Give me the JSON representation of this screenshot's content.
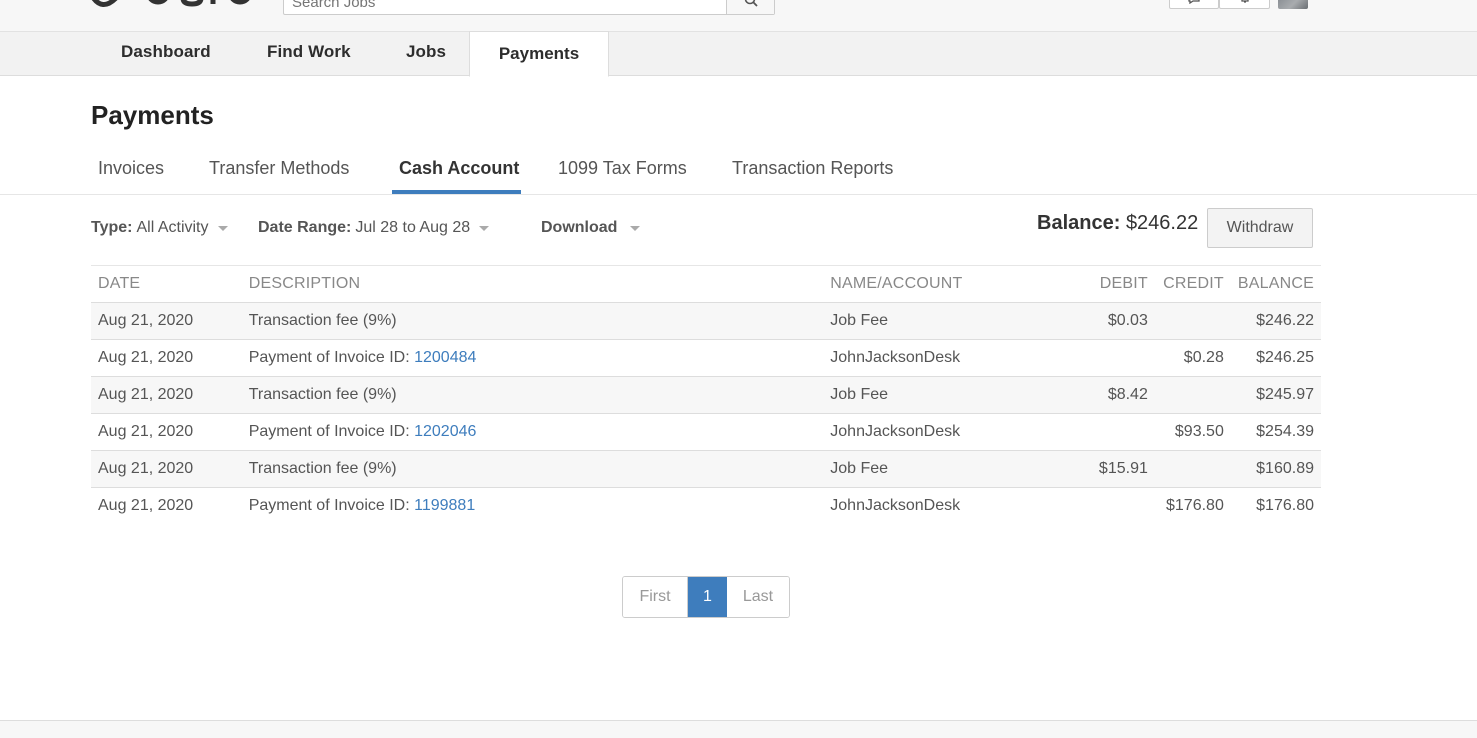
{
  "header": {
    "logo_icon": "logo",
    "search": {
      "placeholder": "Search Jobs"
    },
    "icons": [
      "search-icon",
      "chat-icon",
      "bell-icon",
      "avatar"
    ]
  },
  "main_nav": {
    "items": [
      {
        "label": "Dashboard"
      },
      {
        "label": "Find Work"
      },
      {
        "label": "Jobs"
      },
      {
        "label": "Payments"
      }
    ]
  },
  "page": {
    "title": "Payments",
    "subtabs": [
      {
        "label": "Invoices"
      },
      {
        "label": "Transfer Methods"
      },
      {
        "label": "Cash Account"
      },
      {
        "label": "1099 Tax Forms"
      },
      {
        "label": "Transaction Reports"
      }
    ]
  },
  "filters": {
    "type_label": "Type:",
    "type_value": "All Activity",
    "date_label": "Date Range:",
    "date_value": "Jul 28 to Aug 28",
    "download_label": "Download"
  },
  "balance": {
    "label": "Balance:",
    "value": "$246.22",
    "withdraw_label": "Withdraw"
  },
  "table": {
    "headers": {
      "date": "DATE",
      "description": "DESCRIPTION",
      "name": "NAME/ACCOUNT",
      "debit": "DEBIT",
      "credit": "CREDIT",
      "balance": "BALANCE"
    },
    "rows": [
      {
        "date": "Aug 21, 2020",
        "desc": "Transaction fee (9%)",
        "link": "",
        "name": "Job Fee",
        "debit": "$0.03",
        "credit": "",
        "balance": "$246.22"
      },
      {
        "date": "Aug 21, 2020",
        "desc": "Payment of Invoice ID: ",
        "link": "1200484",
        "name": "JohnJacksonDesk",
        "debit": "",
        "credit": "$0.28",
        "balance": "$246.25"
      },
      {
        "date": "Aug 21, 2020",
        "desc": "Transaction fee (9%)",
        "link": "",
        "name": "Job Fee",
        "debit": "$8.42",
        "credit": "",
        "balance": "$245.97"
      },
      {
        "date": "Aug 21, 2020",
        "desc": "Payment of Invoice ID: ",
        "link": "1202046",
        "name": "JohnJacksonDesk",
        "debit": "",
        "credit": "$93.50",
        "balance": "$254.39"
      },
      {
        "date": "Aug 21, 2020",
        "desc": "Transaction fee (9%)",
        "link": "",
        "name": "Job Fee",
        "debit": "$15.91",
        "credit": "",
        "balance": "$160.89"
      },
      {
        "date": "Aug 21, 2020",
        "desc": "Payment of Invoice ID: ",
        "link": "1199881",
        "name": "JohnJacksonDesk",
        "debit": "",
        "credit": "$176.80",
        "balance": "$176.80"
      }
    ]
  },
  "pagination": {
    "first": "First",
    "current": "1",
    "last": "Last"
  },
  "colors": {
    "accent": "#3e7dbd",
    "nav_bg": "#f2f2f2",
    "row_alt": "#f7f7f7"
  }
}
